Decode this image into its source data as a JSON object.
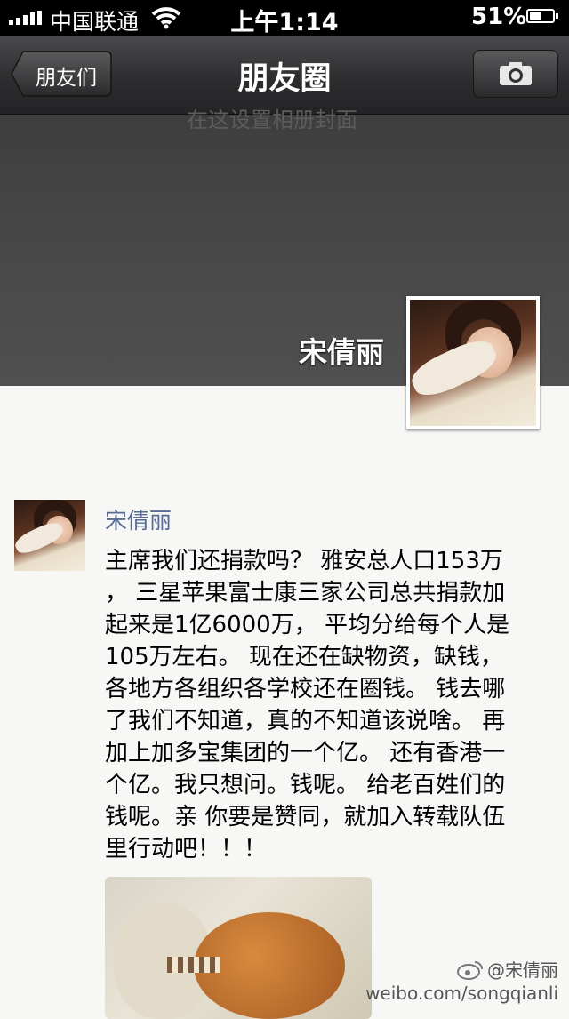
{
  "status_bar": {
    "carrier": "中国联通",
    "time": "上午1:14",
    "battery": "51%",
    "battery_level": 0.51
  },
  "nav": {
    "back_label": "朋友们",
    "title": "朋友圈",
    "camera_icon": "camera-icon"
  },
  "cover": {
    "ghost_text": "在这设置相册封面",
    "name": "宋倩丽"
  },
  "post": {
    "author": "宋倩丽",
    "text": "主席我们还捐款吗？ 雅安总人口153万\n， 三星苹果富士康三家公司总共捐款加\n起来是1亿6000万， 平均分给每个人是\n105万左右。 现在还在缺物资，缺钱，\n各地方各组织各学校还在圈钱。 钱去哪\n了我们不知道，真的不知道该说啥。 再\n加上加多宝集团的一个亿。 还有香港一\n个亿。我只想问。钱呢。 给老百姓们的\n钱呢。亲 你要是赞同，就加入转载队伍\n里行动吧！！！"
  },
  "watermark": {
    "handle": "@宋倩丽",
    "url": "weibo.com/songqianli"
  }
}
